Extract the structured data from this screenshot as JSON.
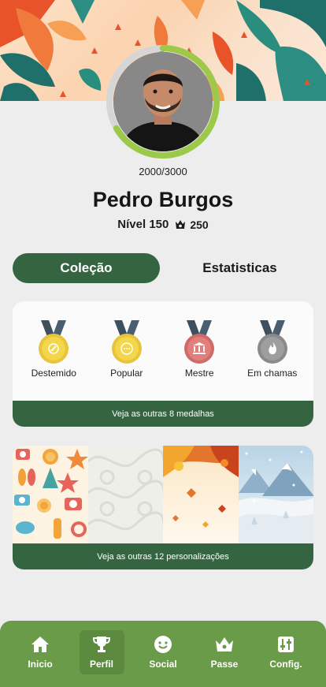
{
  "profile": {
    "xp_text": "2000/3000",
    "xp_progress": 0.667,
    "name": "Pedro Burgos",
    "level_text": "Nível 150",
    "coins": "250"
  },
  "tabs": [
    {
      "label": "Coleção",
      "active": true
    },
    {
      "label": "Estatisticas",
      "active": false
    }
  ],
  "medals": {
    "items": [
      {
        "label": "Destemido",
        "color": "#f3d64a",
        "icon": "compass-icon"
      },
      {
        "label": "Popular",
        "color": "#f3d64a",
        "icon": "chat-bubble-icon"
      },
      {
        "label": "Mestre",
        "color": "#e07f7b",
        "icon": "temple-icon"
      },
      {
        "label": "Em chamas",
        "color": "#9e9e9e",
        "icon": "flame-icon"
      }
    ],
    "footer": "Veja as outras 8 medalhas"
  },
  "themes": {
    "items": [
      {
        "name": "summer-theme"
      },
      {
        "name": "floral-pattern-theme"
      },
      {
        "name": "autumn-theme"
      },
      {
        "name": "winter-theme"
      }
    ],
    "footer": "Veja as outras 12 personalizações"
  },
  "nav": [
    {
      "label": "Inicio",
      "icon": "home-icon",
      "active": false
    },
    {
      "label": "Perfil",
      "icon": "trophy-icon",
      "active": true
    },
    {
      "label": "Social",
      "icon": "smiley-icon",
      "active": false
    },
    {
      "label": "Passe",
      "icon": "crown-icon",
      "active": false
    },
    {
      "label": "Config.",
      "icon": "sliders-icon",
      "active": false
    }
  ],
  "colors": {
    "accent_green": "#346540",
    "progress_green": "#9cc94a",
    "nav_green": "#6a9b48"
  }
}
